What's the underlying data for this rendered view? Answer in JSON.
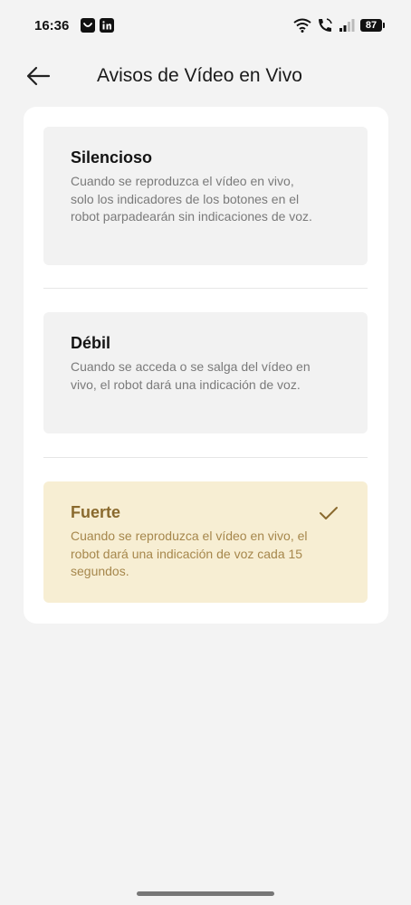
{
  "status_bar": {
    "time": "16:36",
    "battery": "87"
  },
  "header": {
    "title": "Avisos de Vídeo en Vivo",
    "back_icon": "arrow-left-icon"
  },
  "options": [
    {
      "title": "Silencioso",
      "description": "Cuando se reproduzca el vídeo en vivo, solo los indicadores de los botones en el robot parpadearán sin indicaciones de voz.",
      "selected": false
    },
    {
      "title": "Débil",
      "description": "Cuando se acceda o se salga del vídeo en vivo, el robot dará una indicación de voz.",
      "selected": false
    },
    {
      "title": "Fuerte",
      "description": "Cuando se reproduzca el vídeo en vivo, el robot dará una indicación de voz cada 15 segundos.",
      "selected": true
    }
  ],
  "colors": {
    "selected_background": "#f7eed3",
    "selected_text": "#8a6a2e",
    "page_background": "#f3f3f3"
  }
}
